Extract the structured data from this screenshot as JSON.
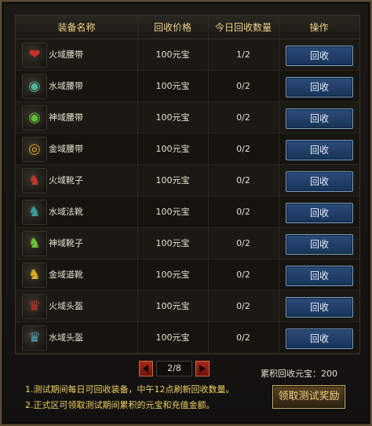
{
  "table": {
    "headers": {
      "name": "装备名称",
      "price": "回收价格",
      "today": "今日回收数量",
      "action": "操作"
    },
    "rows": [
      {
        "icon": "fire-belt-icon",
        "glyph": "❤",
        "color": "#c8322a",
        "name": "火域腰带",
        "price": "100元宝",
        "count": "1/2",
        "button": "回收"
      },
      {
        "icon": "water-belt-icon",
        "glyph": "◉",
        "color": "#4fb39a",
        "name": "水域腰带",
        "price": "100元宝",
        "count": "0/2",
        "button": "回收"
      },
      {
        "icon": "divine-belt-icon",
        "glyph": "◉",
        "color": "#5fbf3a",
        "name": "神域腰带",
        "price": "100元宝",
        "count": "0/2",
        "button": "回收"
      },
      {
        "icon": "gold-belt-icon",
        "glyph": "◎",
        "color": "#d7a11e",
        "name": "金域腰带",
        "price": "100元宝",
        "count": "0/2",
        "button": "回收"
      },
      {
        "icon": "fire-boots-icon",
        "glyph": "♞",
        "color": "#c23a2f",
        "name": "火域靴子",
        "price": "100元宝",
        "count": "0/2",
        "button": "回收"
      },
      {
        "icon": "water-boots-icon",
        "glyph": "♞",
        "color": "#3aa39b",
        "name": "水域法靴",
        "price": "100元宝",
        "count": "0/2",
        "button": "回收"
      },
      {
        "icon": "divine-boots-icon",
        "glyph": "♞",
        "color": "#6acb3b",
        "name": "神域靴子",
        "price": "100元宝",
        "count": "0/2",
        "button": "回收"
      },
      {
        "icon": "gold-boots-icon",
        "glyph": "♞",
        "color": "#e0b021",
        "name": "金域道靴",
        "price": "100元宝",
        "count": "0/2",
        "button": "回收"
      },
      {
        "icon": "fire-helmet-icon",
        "glyph": "♛",
        "color": "#c0322a",
        "name": "火域头盔",
        "price": "100元宝",
        "count": "0/2",
        "button": "回收"
      },
      {
        "icon": "water-helmet-icon",
        "glyph": "♛",
        "color": "#4a9fb0",
        "name": "水域头盔",
        "price": "100元宝",
        "count": "0/2",
        "button": "回收"
      }
    ]
  },
  "pager": {
    "text": "2/8"
  },
  "footer": {
    "total": "累积回收元宝：200",
    "notes": [
      "1.测试期间每日可回收装备，中午12点刷新回收数量。",
      "2.正式区可领取测试期间累积的元宝和充值金额。"
    ],
    "claim_button": "领取测试奖励"
  }
}
